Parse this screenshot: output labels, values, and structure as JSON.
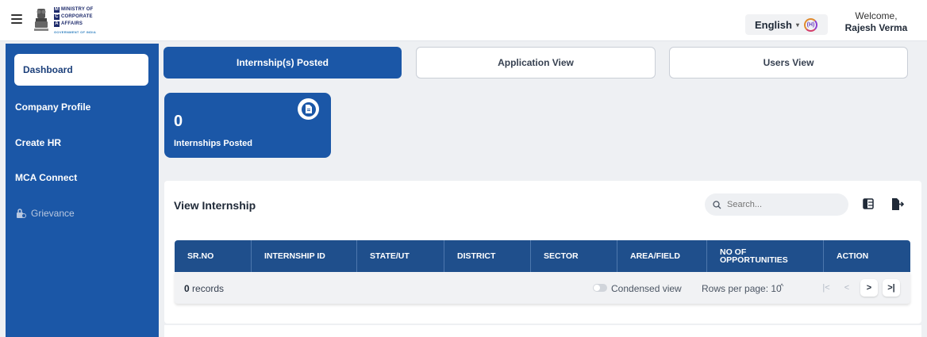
{
  "header": {
    "logo": {
      "line1_letter": "M",
      "line1": "MINISTRY OF",
      "line2_letter": "C",
      "line2": "CORPORATE",
      "line3_letter": "A",
      "line3": "AFFAIRS",
      "subtitle": "GOVERNMENT OF INDIA"
    },
    "language": "English",
    "language_badge": "(H)",
    "welcome": "Welcome,",
    "user_name": "Rajesh Verma"
  },
  "sidebar": {
    "items": [
      {
        "label": "Dashboard",
        "active": true
      },
      {
        "label": "Company Profile"
      },
      {
        "label": "Create HR"
      },
      {
        "label": "MCA Connect"
      },
      {
        "label": "Grievance",
        "disabled": true
      }
    ]
  },
  "tabs": [
    {
      "label": "Internship(s) Posted",
      "active": true
    },
    {
      "label": "Application View"
    },
    {
      "label": "Users View"
    }
  ],
  "stat_card": {
    "value": "0",
    "label": "Internships Posted"
  },
  "panel": {
    "title": "View Internship",
    "search_placeholder": "Search..."
  },
  "table": {
    "columns": [
      "SR.NO",
      "INTERNSHIP ID",
      "STATE/UT",
      "DISTRICT",
      "SECTOR",
      "AREA/FIELD",
      "NO OF OPPORTUNITIES",
      "ACTION"
    ],
    "footer": {
      "records_count": "0",
      "records_label": " records",
      "condensed_label": "Condensed view",
      "rows_per_page": "Rows per page: 10"
    }
  },
  "colors": {
    "primary": "#1b57a7",
    "table_header": "#1f4f8c",
    "background": "#eef0f3"
  }
}
